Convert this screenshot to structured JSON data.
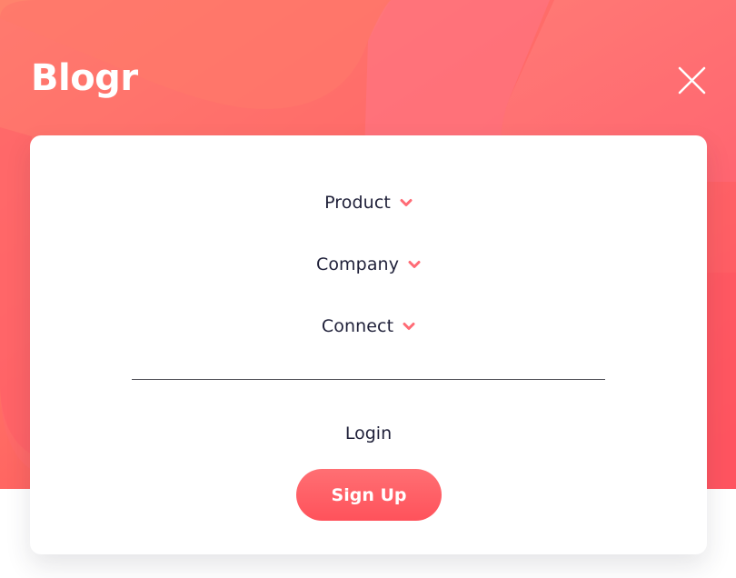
{
  "brand": {
    "logo_text": "Blogr"
  },
  "colors": {
    "gradient_start": "#ff8f70",
    "gradient_end": "#ff3d54",
    "accent": "#ff525b",
    "text_dark": "#1f2039"
  },
  "header": {
    "close_icon": "close-icon"
  },
  "menu": {
    "items": [
      {
        "label": "Product",
        "icon": "chevron-down-icon"
      },
      {
        "label": "Company",
        "icon": "chevron-down-icon"
      },
      {
        "label": "Connect",
        "icon": "chevron-down-icon"
      }
    ],
    "login_label": "Login",
    "signup_label": "Sign Up"
  }
}
